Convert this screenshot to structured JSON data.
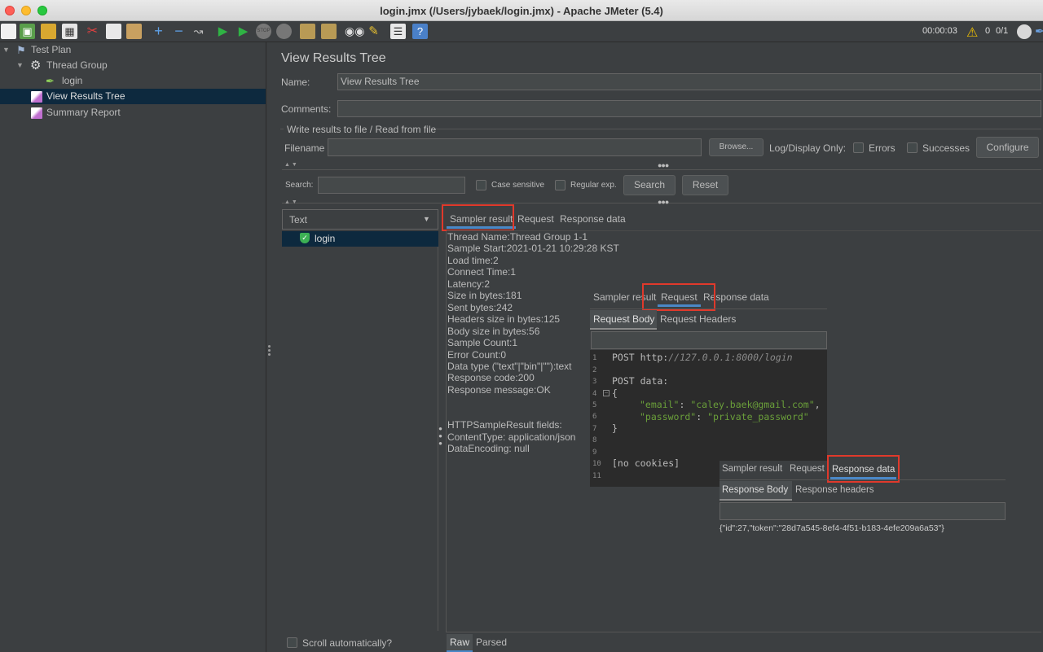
{
  "window": {
    "title": "login.jmx (/Users/jybaek/login.jmx) - Apache JMeter (5.4)"
  },
  "toolbar": {
    "elapsed": "00:00:03",
    "warn_count": "0",
    "threads": "0/1"
  },
  "tree": {
    "items": [
      {
        "label": "Test Plan",
        "icon": "test-plan-icon"
      },
      {
        "label": "Thread Group",
        "icon": "gear-icon"
      },
      {
        "label": "login",
        "icon": "sampler-pen-icon"
      },
      {
        "label": "View Results Tree",
        "icon": "graph-icon",
        "selected": true
      },
      {
        "label": "Summary Report",
        "icon": "graph-icon"
      }
    ]
  },
  "panel": {
    "heading": "View Results Tree",
    "name_label": "Name:",
    "name_value": "View Results Tree",
    "comments_label": "Comments:",
    "comments_value": "",
    "file_section": "Write results to file / Read from file",
    "filename_label": "Filename",
    "browse": "Browse...",
    "logdisplay": "Log/Display Only:",
    "errors": "Errors",
    "successes": "Successes",
    "configure": "Configure",
    "search_label": "Search:",
    "case_sensitive": "Case sensitive",
    "regular_exp": "Regular exp.",
    "search_btn": "Search",
    "reset_btn": "Reset",
    "renderer": "Text",
    "result_item": "login",
    "scroll_auto": "Scroll automatically?",
    "bottom_tabs": [
      "Raw",
      "Parsed"
    ]
  },
  "sampler_tabs": [
    "Sampler result",
    "Request",
    "Response data"
  ],
  "sampler_result": {
    "lines": [
      "Thread Name:Thread Group 1-1",
      "Sample Start:2021-01-21 10:29:28 KST",
      "Load time:2",
      "Connect Time:1",
      "Latency:2",
      "Size in bytes:181",
      "Sent bytes:242",
      "Headers size in bytes:125",
      "Body size in bytes:56",
      "Sample Count:1",
      "Error Count:0",
      "Data type (\"text\"|\"bin\"|\"\"):text",
      "Response code:200",
      "Response message:OK"
    ],
    "fields_lines": [
      "HTTPSampleResult fields:",
      "ContentType: application/json",
      "DataEncoding: null"
    ]
  },
  "request_overlay": {
    "tabs": [
      "Sampler result",
      "Request",
      "Response data"
    ],
    "subtabs": [
      "Request Body",
      "Request Headers"
    ],
    "post_prefix": "POST http:",
    "post_url": "//127.0.0.1:8000/login",
    "post_data": "POST data:",
    "open_brace": "{",
    "email_key": "\"email\"",
    "email_val": "\"caley.baek@gmail.com\"",
    "password_key": "\"password\"",
    "password_val": "\"private_password\"",
    "close_brace": "}",
    "no_cookies": "[no cookies]",
    "line_numbers": [
      "1",
      "2",
      "3",
      "4",
      "5",
      "6",
      "7",
      "8",
      "9",
      "10",
      "11"
    ]
  },
  "response_overlay": {
    "tabs": [
      "Sampler result",
      "Request",
      "Response data"
    ],
    "subtabs": [
      "Response Body",
      "Response headers"
    ],
    "body": "{\"id\":27,\"token\":\"28d7a545-8ef4-4f51-b183-4efe209a6a53\"}"
  }
}
